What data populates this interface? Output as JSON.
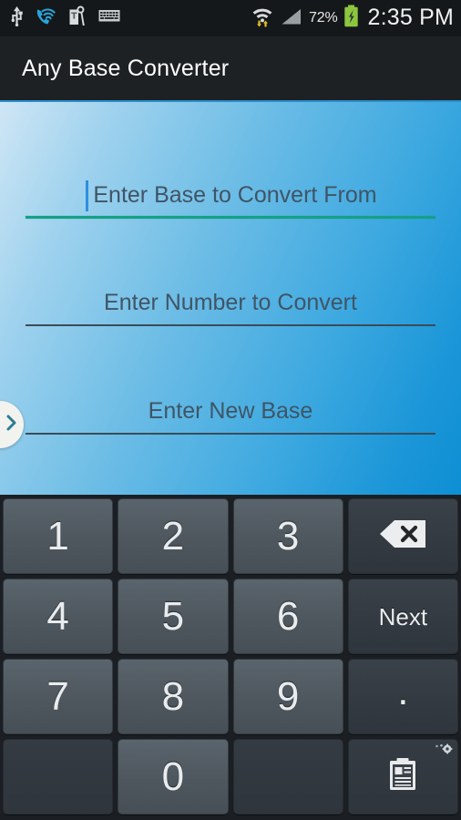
{
  "status_bar": {
    "left_icons": [
      {
        "name": "usb-icon",
        "label": "USB"
      },
      {
        "name": "wifi-calling-icon",
        "label": "WiFi Calling"
      },
      {
        "name": "tmobile-tag-icon",
        "label": "T-Mobile"
      },
      {
        "name": "keyboard-icon",
        "label": "Keyboard"
      }
    ],
    "wifi_icon": "wifi-transfer-icon",
    "signal_icon": "cellular-signal-icon",
    "battery_percent": "72%",
    "battery_icon": "battery-charging-icon",
    "battery_color": "#8cc63f",
    "clock": "2:35 PM",
    "background": "#15181a"
  },
  "action_bar": {
    "title": "Any Base Converter",
    "background": "#1e2124",
    "accent": "#2b8fcc"
  },
  "content": {
    "background_gradient_from": "#cfe6f5",
    "background_gradient_to": "#0e8fd4",
    "fields": [
      {
        "name": "base-from-field",
        "placeholder": "Enter Base to Convert From",
        "value": "",
        "focused": true,
        "underline_color": "#14a085",
        "caret_color": "#2d8fe0",
        "align": "left-of-center"
      },
      {
        "name": "number-field",
        "placeholder": "Enter Number to Convert",
        "value": "",
        "focused": false,
        "underline_color": "#3a4c59",
        "align": "center"
      },
      {
        "name": "new-base-field",
        "placeholder": "Enter New Base",
        "value": "",
        "focused": false,
        "underline_color": "#3a4c59",
        "align": "center"
      }
    ],
    "drawer_tab": {
      "name": "drawer-handle",
      "icon": "chevron-right-icon",
      "icon_color": "#2d7d93",
      "background": "#f2f2ee"
    }
  },
  "keyboard": {
    "background": "#1b1f23",
    "rows": [
      [
        {
          "name": "key-1",
          "label": "1",
          "type": "digit"
        },
        {
          "name": "key-2",
          "label": "2",
          "type": "digit"
        },
        {
          "name": "key-3",
          "label": "3",
          "type": "digit"
        },
        {
          "name": "key-backspace",
          "label": "",
          "type": "backspace",
          "icon": "backspace-icon"
        }
      ],
      [
        {
          "name": "key-4",
          "label": "4",
          "type": "digit"
        },
        {
          "name": "key-5",
          "label": "5",
          "type": "digit"
        },
        {
          "name": "key-6",
          "label": "6",
          "type": "digit"
        },
        {
          "name": "key-next",
          "label": "Next",
          "type": "action"
        }
      ],
      [
        {
          "name": "key-7",
          "label": "7",
          "type": "digit"
        },
        {
          "name": "key-8",
          "label": "8",
          "type": "digit"
        },
        {
          "name": "key-9",
          "label": "9",
          "type": "digit"
        },
        {
          "name": "key-period",
          "label": ".",
          "type": "punct"
        }
      ],
      [
        {
          "name": "key-blank-left",
          "label": "",
          "type": "blank"
        },
        {
          "name": "key-0",
          "label": "0",
          "type": "digit"
        },
        {
          "name": "key-blank-right",
          "label": "",
          "type": "blank"
        },
        {
          "name": "key-clipboard",
          "label": "",
          "type": "clipboard",
          "icon": "clipboard-icon",
          "badge_icon": "gear-icon"
        }
      ]
    ]
  }
}
